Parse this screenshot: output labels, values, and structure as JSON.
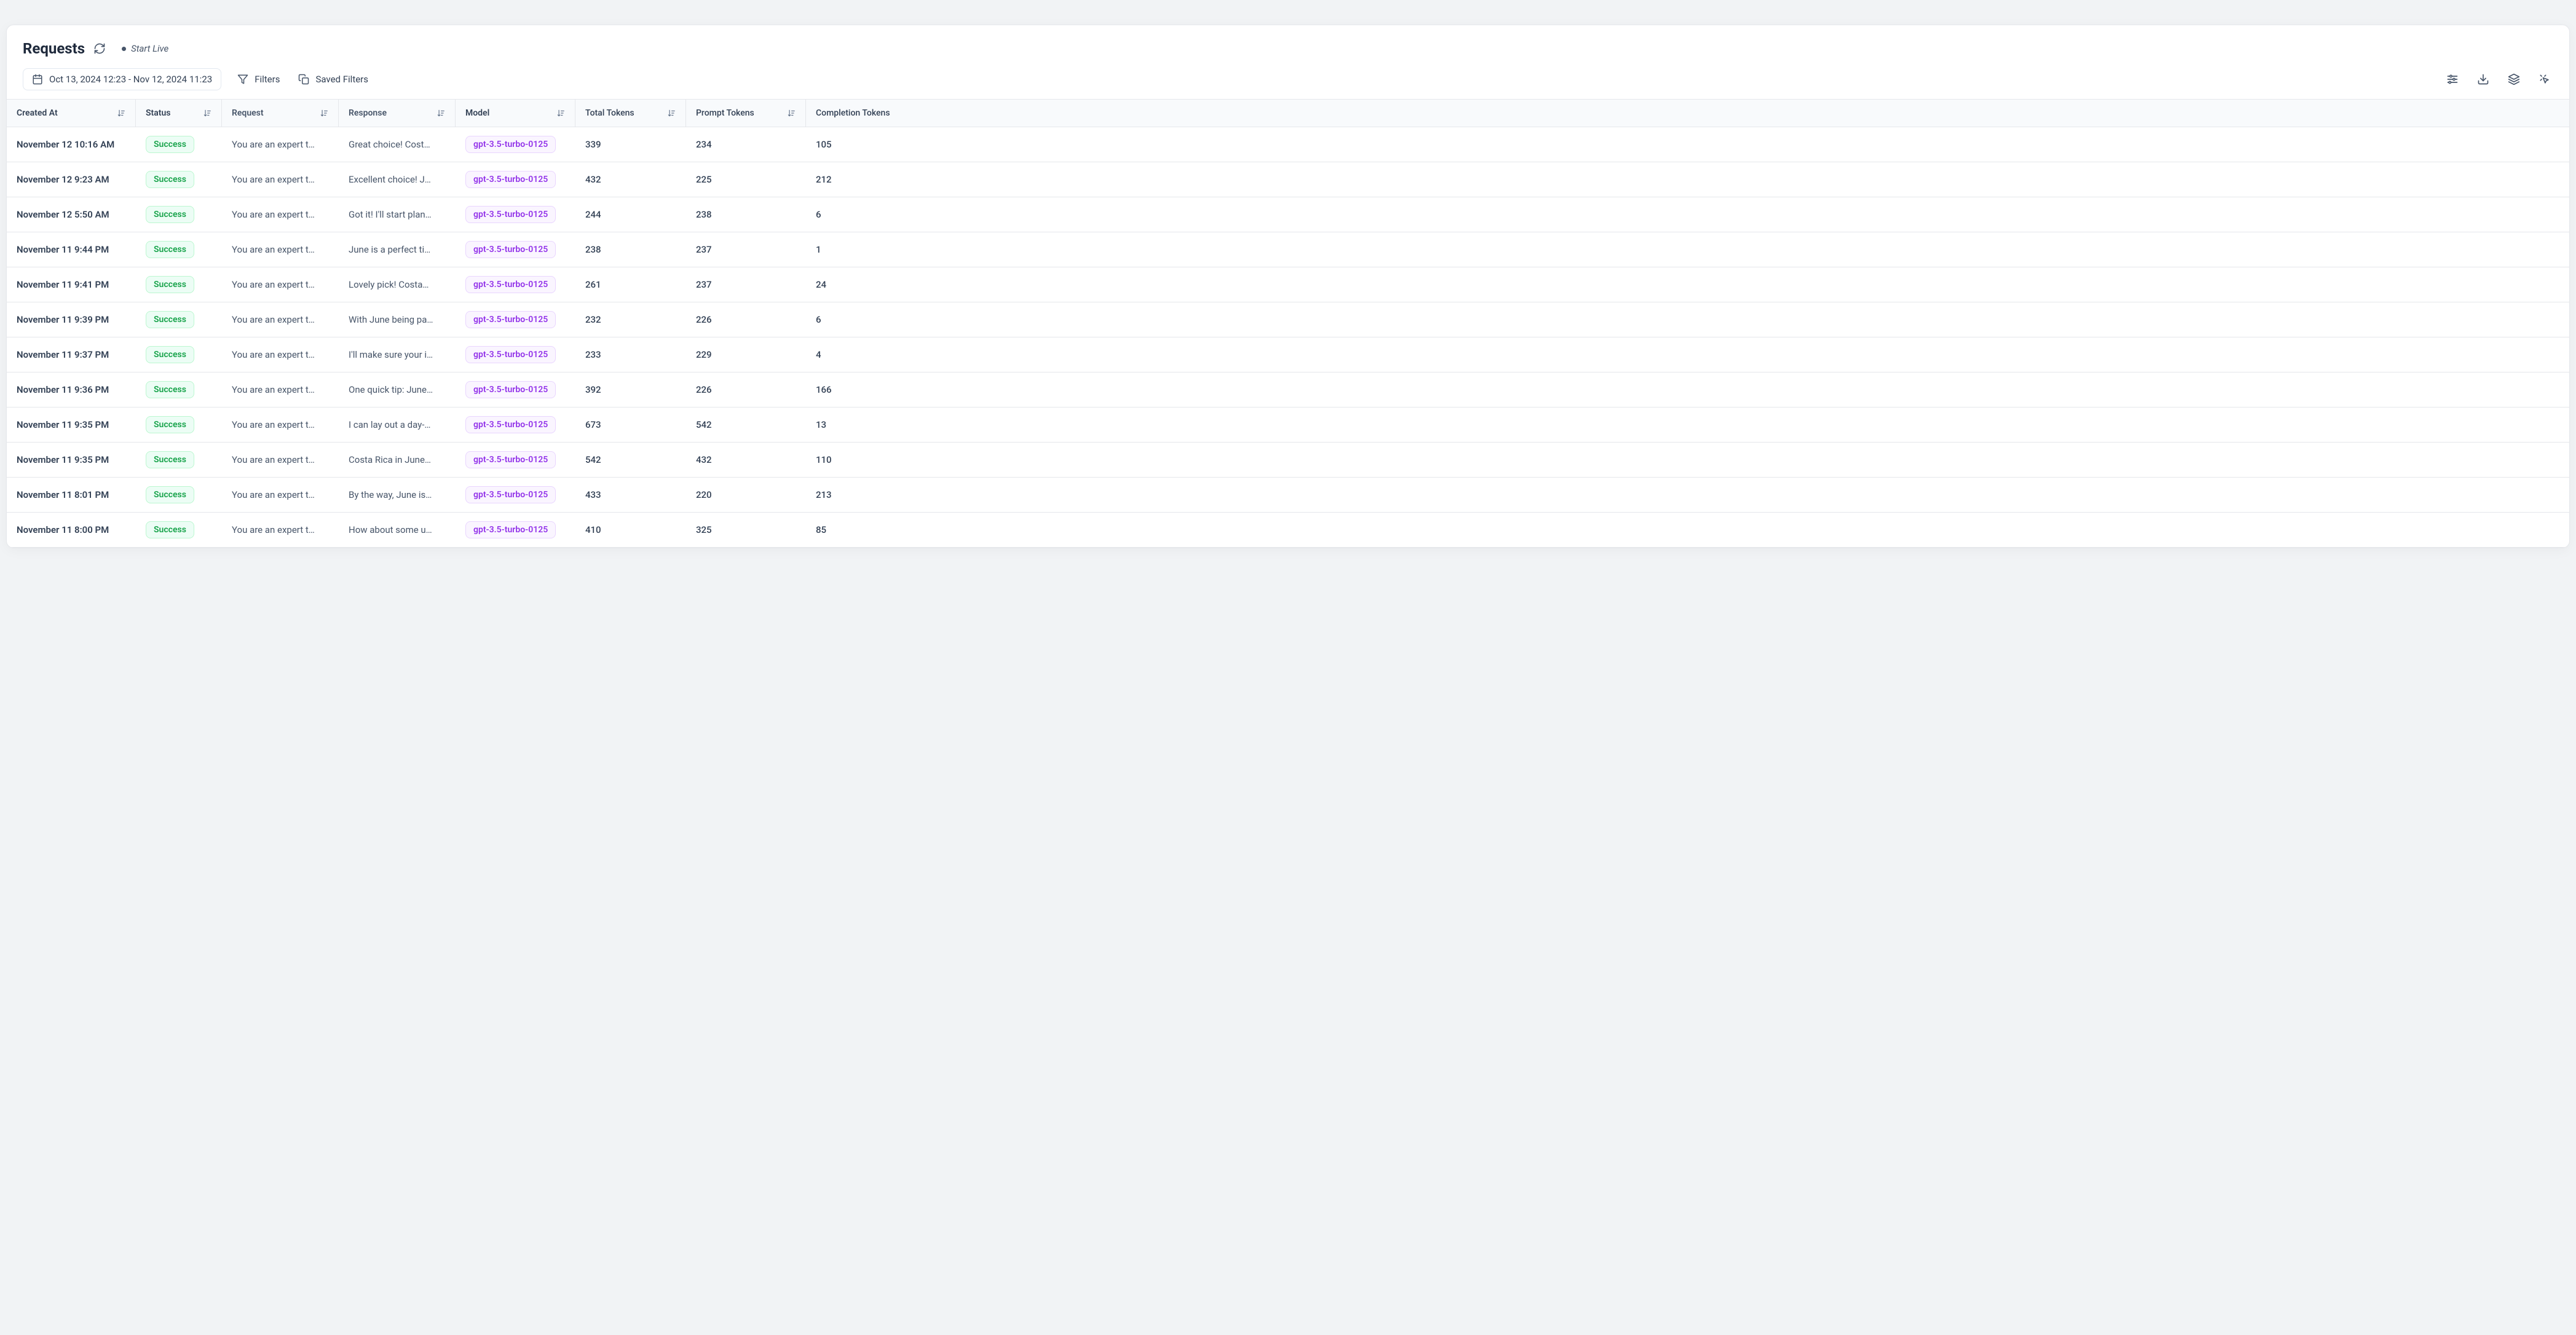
{
  "header": {
    "title": "Requests",
    "start_live": "Start Live"
  },
  "toolbar": {
    "date_range": "Oct 13, 2024 12:23 - Nov 12, 2024 11:23",
    "filters_label": "Filters",
    "saved_filters_label": "Saved Filters"
  },
  "columns": {
    "created_at": "Created At",
    "status": "Status",
    "request": "Request",
    "response": "Response",
    "model": "Model",
    "total_tokens": "Total Tokens",
    "prompt_tokens": "Prompt Tokens",
    "completion_tokens": "Completion Tokens"
  },
  "rows": [
    {
      "created_at": "November 12 10:16 AM",
      "status": "Success",
      "request": "You are an expert t…",
      "response": "Great choice! Cost…",
      "model": "gpt-3.5-turbo-0125",
      "total_tokens": "339",
      "prompt_tokens": "234",
      "completion_tokens": "105"
    },
    {
      "created_at": "November 12 9:23 AM",
      "status": "Success",
      "request": "You are an expert t…",
      "response": "Excellent choice! J…",
      "model": "gpt-3.5-turbo-0125",
      "total_tokens": "432",
      "prompt_tokens": "225",
      "completion_tokens": "212"
    },
    {
      "created_at": "November 12 5:50 AM",
      "status": "Success",
      "request": "You are an expert t…",
      "response": "Got it! I'll start plan…",
      "model": "gpt-3.5-turbo-0125",
      "total_tokens": "244",
      "prompt_tokens": "238",
      "completion_tokens": "6"
    },
    {
      "created_at": "November 11 9:44 PM",
      "status": "Success",
      "request": "You are an expert t…",
      "response": "June is a perfect ti…",
      "model": "gpt-3.5-turbo-0125",
      "total_tokens": "238",
      "prompt_tokens": "237",
      "completion_tokens": "1"
    },
    {
      "created_at": "November 11 9:41 PM",
      "status": "Success",
      "request": "You are an expert t…",
      "response": "Lovely pick! Costa…",
      "model": "gpt-3.5-turbo-0125",
      "total_tokens": "261",
      "prompt_tokens": "237",
      "completion_tokens": "24"
    },
    {
      "created_at": "November 11 9:39 PM",
      "status": "Success",
      "request": "You are an expert t…",
      "response": "With June being pa…",
      "model": "gpt-3.5-turbo-0125",
      "total_tokens": "232",
      "prompt_tokens": "226",
      "completion_tokens": "6"
    },
    {
      "created_at": "November 11 9:37 PM",
      "status": "Success",
      "request": "You are an expert t…",
      "response": "I'll make sure your i…",
      "model": "gpt-3.5-turbo-0125",
      "total_tokens": "233",
      "prompt_tokens": "229",
      "completion_tokens": "4"
    },
    {
      "created_at": "November 11 9:36 PM",
      "status": "Success",
      "request": "You are an expert t…",
      "response": "One quick tip: June…",
      "model": "gpt-3.5-turbo-0125",
      "total_tokens": "392",
      "prompt_tokens": "226",
      "completion_tokens": "166"
    },
    {
      "created_at": "November 11 9:35 PM",
      "status": "Success",
      "request": "You are an expert t…",
      "response": "I can lay out a day-…",
      "model": "gpt-3.5-turbo-0125",
      "total_tokens": "673",
      "prompt_tokens": "542",
      "completion_tokens": "13"
    },
    {
      "created_at": "November 11 9:35 PM",
      "status": "Success",
      "request": "You are an expert t…",
      "response": "Costa Rica in June…",
      "model": "gpt-3.5-turbo-0125",
      "total_tokens": "542",
      "prompt_tokens": "432",
      "completion_tokens": "110"
    },
    {
      "created_at": "November 11 8:01 PM",
      "status": "Success",
      "request": "You are an expert t…",
      "response": "By the way, June is…",
      "model": "gpt-3.5-turbo-0125",
      "total_tokens": "433",
      "prompt_tokens": "220",
      "completion_tokens": "213"
    },
    {
      "created_at": "November 11 8:00 PM",
      "status": "Success",
      "request": "You are an expert t…",
      "response": "How about some u…",
      "model": "gpt-3.5-turbo-0125",
      "total_tokens": "410",
      "prompt_tokens": "325",
      "completion_tokens": "85"
    }
  ]
}
